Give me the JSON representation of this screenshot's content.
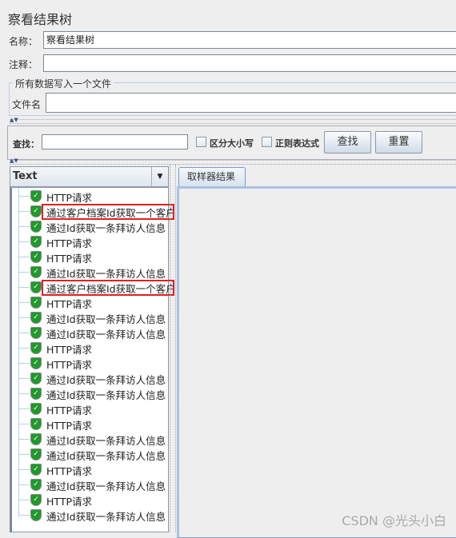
{
  "title": "察看结果树",
  "name_label": "名称：",
  "name_value": "察看结果树",
  "comment_label": "注释：",
  "comment_value": "",
  "file_group_title": "所有数据写入一个文件",
  "file_label": "文件名",
  "file_value": "",
  "search": {
    "label": "查找：",
    "value": "",
    "case_label": "区分大小写",
    "case_checked": false,
    "regex_label": "正则表达式",
    "regex_checked": false,
    "find_button": "查找",
    "reset_button": "重置"
  },
  "renderer_select": "Text",
  "tab_label": "取样器结果",
  "tree_items": [
    {
      "label": "HTTP请求",
      "status": "success",
      "highlighted": false
    },
    {
      "label": "通过客户档案Id获取一个客户",
      "status": "success",
      "highlighted": true
    },
    {
      "label": "通过Id获取一条拜访人信息",
      "status": "success",
      "highlighted": false
    },
    {
      "label": "HTTP请求",
      "status": "success",
      "highlighted": false
    },
    {
      "label": "HTTP请求",
      "status": "success",
      "highlighted": false
    },
    {
      "label": "通过Id获取一条拜访人信息",
      "status": "success",
      "highlighted": false
    },
    {
      "label": "通过客户档案Id获取一个客户",
      "status": "success",
      "highlighted": true
    },
    {
      "label": "HTTP请求",
      "status": "success",
      "highlighted": false
    },
    {
      "label": "通过Id获取一条拜访人信息",
      "status": "success",
      "highlighted": false
    },
    {
      "label": "通过Id获取一条拜访人信息",
      "status": "success",
      "highlighted": false
    },
    {
      "label": "HTTP请求",
      "status": "success",
      "highlighted": false
    },
    {
      "label": "HTTP请求",
      "status": "success",
      "highlighted": false
    },
    {
      "label": "通过Id获取一条拜访人信息",
      "status": "success",
      "highlighted": false
    },
    {
      "label": "通过Id获取一条拜访人信息",
      "status": "success",
      "highlighted": false
    },
    {
      "label": "HTTP请求",
      "status": "success",
      "highlighted": false
    },
    {
      "label": "HTTP请求",
      "status": "success",
      "highlighted": false
    },
    {
      "label": "通过Id获取一条拜访人信息",
      "status": "success",
      "highlighted": false
    },
    {
      "label": "通过Id获取一条拜访人信息",
      "status": "success",
      "highlighted": false
    },
    {
      "label": "HTTP请求",
      "status": "success",
      "highlighted": false
    },
    {
      "label": "通过Id获取一条拜访人信息",
      "status": "success",
      "highlighted": false
    },
    {
      "label": "HTTP请求",
      "status": "success",
      "highlighted": false
    },
    {
      "label": "通过Id获取一条拜访人信息",
      "status": "success",
      "highlighted": false
    }
  ],
  "colors": {
    "success": "#1e9a2a",
    "highlight_border": "#e02020",
    "tab_border": "#7a9acc"
  },
  "watermark": "CSDN @光头小白"
}
